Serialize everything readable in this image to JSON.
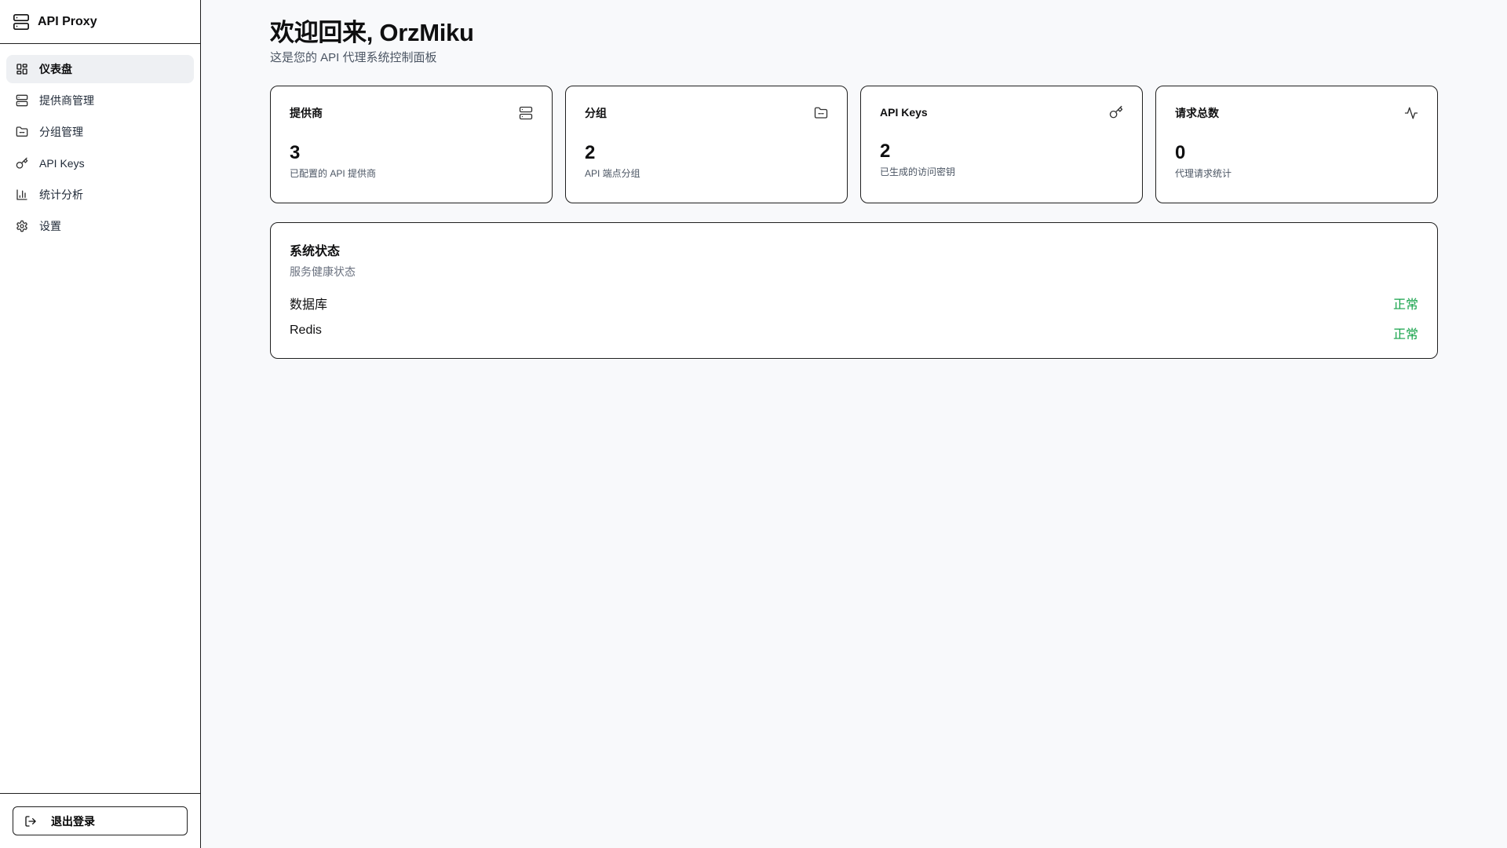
{
  "brand": {
    "title": "API Proxy",
    "icon": "server-icon"
  },
  "sidebar": {
    "items": [
      {
        "label": "仪表盘",
        "icon": "dashboard-grid-icon",
        "active": true
      },
      {
        "label": "提供商管理",
        "icon": "server-icon",
        "active": false
      },
      {
        "label": "分组管理",
        "icon": "folder-icon",
        "active": false
      },
      {
        "label": "API Keys",
        "icon": "key-icon",
        "active": false
      },
      {
        "label": "统计分析",
        "icon": "bar-chart-icon",
        "active": false
      },
      {
        "label": "设置",
        "icon": "gear-icon",
        "active": false
      }
    ],
    "logout_label": "退出登录"
  },
  "header": {
    "welcome": "欢迎回来, OrzMiku",
    "subtitle": "这是您的 API 代理系统控制面板"
  },
  "cards": [
    {
      "title": "提供商",
      "value": "3",
      "desc": "已配置的 API 提供商",
      "icon": "server-icon"
    },
    {
      "title": "分组",
      "value": "2",
      "desc": "API 端点分组",
      "icon": "folder-icon"
    },
    {
      "title": "API Keys",
      "value": "2",
      "desc": "已生成的访问密钥",
      "icon": "key-icon"
    },
    {
      "title": "请求总数",
      "value": "0",
      "desc": "代理请求统计",
      "icon": "activity-icon"
    }
  ],
  "status": {
    "title": "系统状态",
    "subtitle": "服务健康状态",
    "rows": [
      {
        "name": "数据库",
        "value": "正常"
      },
      {
        "name": "Redis",
        "value": "正常"
      }
    ]
  },
  "colors": {
    "ok": "#16a34a",
    "border": "#1f1f1f",
    "background": "#f8f9fb"
  }
}
